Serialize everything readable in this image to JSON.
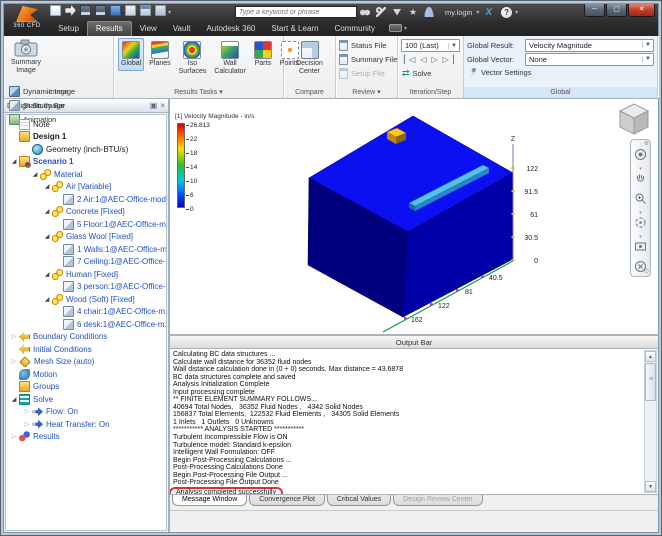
{
  "titlebar": {
    "logo": "360 CFD",
    "search_placeholder": "Type a keyword or phrase",
    "login": "my.login",
    "qat_icons": [
      "new-file",
      "open",
      "save",
      "save-as",
      "undo-menu",
      "redo-menu",
      "status",
      "customize"
    ],
    "search_icons": [
      "binoculars",
      "key",
      "send",
      "star",
      "user"
    ]
  },
  "menu_tabs": [
    {
      "label": "Setup"
    },
    {
      "label": "Results",
      "active": true
    },
    {
      "label": "View"
    },
    {
      "label": "Vault"
    },
    {
      "label": "Autodesk 360"
    },
    {
      "label": "Start & Learn"
    },
    {
      "label": "Community"
    }
  ],
  "ribbon": {
    "image": {
      "label": "Image",
      "big_button": "Summary Image",
      "buttons": [
        "Dynamic Image",
        "Static Image",
        "Animation"
      ]
    },
    "results_tasks": {
      "label": "Results Tasks ▾",
      "buttons": [
        {
          "label": "Global",
          "icon": "global",
          "selected": true
        },
        {
          "label": "Planes",
          "icon": "planes"
        },
        {
          "label": "Iso Surfaces",
          "icon": "iso"
        },
        {
          "label": "Wall Calculator",
          "icon": "wall"
        },
        {
          "label": "Parts",
          "icon": "parts"
        },
        {
          "label": "Points",
          "icon": "points"
        }
      ]
    },
    "compare": {
      "label": "Compare",
      "button": "Decision Center"
    },
    "review": {
      "label": "Review ▾",
      "buttons": [
        {
          "label": "Status File"
        },
        {
          "label": "Summary File"
        },
        {
          "label": "Setup File",
          "disabled": true
        }
      ]
    },
    "iteration": {
      "label": "Iteration/Step",
      "dropdown": "100 (Last)",
      "solve": "Solve",
      "steps": [
        "step-first",
        "step-back",
        "step-forward",
        "step-last"
      ]
    },
    "global": {
      "label": "Global",
      "rows": [
        {
          "label": "Global Result:",
          "value": "Velocity Magnitude"
        },
        {
          "label": "Global Vector:",
          "value": "None"
        }
      ],
      "vector_settings": "Vector Settings"
    }
  },
  "design_study_bar": {
    "title": "Design Study Bar",
    "items": [
      {
        "label": "Note",
        "indent": 13,
        "icon": "note",
        "color": "black"
      },
      {
        "label": "Design 1",
        "indent": 13,
        "icon": "folder",
        "color": "black",
        "bold": true
      },
      {
        "label": "Geometry (inch-BTU/s)",
        "indent": 26,
        "icon": "geometry",
        "color": "black"
      },
      {
        "label": "Scenario 1",
        "indent": 3,
        "arrow": "exp",
        "icon": "scenario",
        "color": "blue",
        "bold": true
      },
      {
        "label": "Material",
        "indent": 24,
        "arrow": "exp",
        "icon": "balls",
        "color": "blue"
      },
      {
        "label": "Air [Variable]",
        "indent": 36,
        "arrow": "exp",
        "icon": "balls",
        "color": "blue"
      },
      {
        "label": "2 Air:1@AEC-Office-mod...",
        "indent": 57,
        "icon": "cube",
        "color": "blue"
      },
      {
        "label": "Concrete [Fixed]",
        "indent": 36,
        "arrow": "exp",
        "icon": "balls",
        "color": "blue"
      },
      {
        "label": "5 Floor:1@AEC-Office-m...",
        "indent": 57,
        "icon": "cube",
        "color": "blue"
      },
      {
        "label": "Glass Wool [Fixed]",
        "indent": 36,
        "arrow": "exp",
        "icon": "balls",
        "color": "blue"
      },
      {
        "label": "1 Walls:1@AEC-Office-m...",
        "indent": 57,
        "icon": "cube",
        "color": "blue"
      },
      {
        "label": "7 Ceiling:1@AEC-Office-...",
        "indent": 57,
        "icon": "cube",
        "color": "blue"
      },
      {
        "label": "Human [Fixed]",
        "indent": 36,
        "arrow": "exp",
        "icon": "balls",
        "color": "blue"
      },
      {
        "label": "3 person:1@AEC-Office-...",
        "indent": 57,
        "icon": "cube",
        "color": "blue"
      },
      {
        "label": "Wood (Soft) [Fixed]",
        "indent": 36,
        "arrow": "exp",
        "icon": "balls",
        "color": "blue"
      },
      {
        "label": "4 chair:1@AEC-Office-m...",
        "indent": 57,
        "icon": "cube",
        "color": "blue"
      },
      {
        "label": "6 desk:1@AEC-Office-m...",
        "indent": 57,
        "icon": "cube",
        "color": "blue"
      },
      {
        "label": "Boundary Conditions",
        "indent": 3,
        "arrow": "col",
        "icon": "bc",
        "color": "blue"
      },
      {
        "label": "Initial Conditions",
        "indent": 13,
        "icon": "bc",
        "color": "blue"
      },
      {
        "label": "Mesh Size (auto)",
        "indent": 3,
        "arrow": "col",
        "icon": "mesh",
        "color": "blue"
      },
      {
        "label": "Motion",
        "indent": 13,
        "icon": "motion",
        "color": "blue"
      },
      {
        "label": "Groups",
        "indent": 13,
        "icon": "groups",
        "color": "blue"
      },
      {
        "label": "Solve",
        "indent": 3,
        "arrow": "exp",
        "icon": "solve",
        "color": "blue"
      },
      {
        "label": "Flow: On",
        "indent": 16,
        "arrow": "col",
        "icon": "flow",
        "color": "blue"
      },
      {
        "label": "Heat Transfer: On",
        "indent": 16,
        "arrow": "col",
        "icon": "flow",
        "color": "blue"
      },
      {
        "label": "Results",
        "indent": 3,
        "arrow": "col",
        "icon": "results",
        "color": "blue"
      }
    ]
  },
  "viewport": {
    "legend": {
      "title": "[1] Velocity Magnitude - in/s",
      "ticks": [
        "26.813",
        "22",
        "18",
        "14",
        "10",
        "6",
        "0"
      ]
    },
    "axes": {
      "z_label": "Z",
      "z_ticks": [
        "122",
        "91.5",
        "61",
        "30.5",
        "0"
      ],
      "x_ticks": [
        "40.5",
        "81",
        "122",
        "162"
      ]
    },
    "nav_icons": [
      "navigation-wheel",
      "pan",
      "zoom",
      "orbit",
      "look",
      "fit"
    ]
  },
  "output": {
    "header": "Output Bar",
    "lines": [
      "Calculating BC data structures ...",
      "Calculate wall distance for 36352 fluid nodes",
      "Wall distance calculation done in (0 + 0) seconds. Max distance = 43.6878",
      "BC data structures complete and saved",
      "Analysis Initialization Complete",
      "Input processing complete",
      "** FINITE ELEMENT SUMMARY FOLLOWS...",
      "40694 Total Nodes,   36352 Fluid Nodes ,   4342 Solid Nodes",
      "156837 Total Elements,  122532 Fluid Elements ,   34305 Solid Elements",
      "1 Inlets   1 Outlets   0 Unknowns",
      "*********** ANALYSIS STARTED ***********",
      "Turbulent Incompressible Flow is ON",
      "Turbulence model: Standard k-epsilon",
      "Intelligent Wall Formulation: OFF",
      "Begin Post-Processing Calculations ...",
      "Post-Processing Calculations Done",
      "Begin Post-Processing File Output ...",
      "Post-Processing File Output Done",
      "Analysis completed successfully"
    ],
    "highlight": "Analysis completed successfully"
  },
  "bottom_tabs": [
    {
      "label": "Message Window",
      "active": true
    },
    {
      "label": "Convergence Plot"
    },
    {
      "label": "Critical Values"
    },
    {
      "label": "Design Review Center",
      "disabled": true
    }
  ]
}
